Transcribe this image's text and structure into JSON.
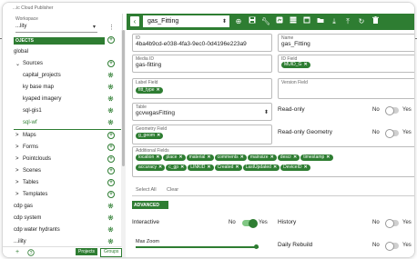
{
  "app": {
    "title": "...ic Cloud Publisher"
  },
  "workspace": {
    "label": "Workspace",
    "value": "...lity"
  },
  "projects_header": "OJECTS",
  "tree": [
    {
      "label": "global",
      "indent": 0,
      "caret": "",
      "action": ""
    },
    {
      "label": "Sources",
      "indent": 2,
      "caret": "⌄",
      "action": "plus"
    },
    {
      "label": "capital_projects",
      "indent": 10,
      "caret": "",
      "action": "gear"
    },
    {
      "label": "ky base map",
      "indent": 10,
      "caret": "",
      "action": "gear"
    },
    {
      "label": "kyaped imagery",
      "indent": 10,
      "caret": "",
      "action": "gear"
    },
    {
      "label": "sql-gis1",
      "indent": 10,
      "caret": "",
      "action": "gear"
    },
    {
      "label": "sql-wf",
      "indent": 10,
      "caret": "",
      "action": "gear",
      "selected": true
    },
    {
      "label": "Maps",
      "indent": 2,
      "caret": ">",
      "action": "plus"
    },
    {
      "label": "Forms",
      "indent": 2,
      "caret": ">",
      "action": "plus"
    },
    {
      "label": "Pointclouds",
      "indent": 2,
      "caret": ">",
      "action": "plus"
    },
    {
      "label": "Scenes",
      "indent": 2,
      "caret": ">",
      "action": "plus"
    },
    {
      "label": "Tables",
      "indent": 2,
      "caret": ">",
      "action": "plus"
    },
    {
      "label": "Templates",
      "indent": 2,
      "caret": ">",
      "action": "plus"
    },
    {
      "label": "cdp gas",
      "indent": 0,
      "caret": "",
      "action": "gear"
    },
    {
      "label": "cdp system",
      "indent": 0,
      "caret": "",
      "action": "gear"
    },
    {
      "label": "cdp water hydrants",
      "indent": 0,
      "caret": "",
      "action": "gear"
    },
    {
      "label": "...ility",
      "indent": 0,
      "caret": "",
      "action": "gear"
    }
  ],
  "footer": {
    "projects_btn": "Projects",
    "groups_btn": "Groups"
  },
  "toolbar": {
    "selected": "gas_Fitting",
    "icons": [
      "add-circle-icon",
      "save-icon",
      "wrench-icon",
      "map-icon",
      "table-icon",
      "window-icon",
      "folder-icon",
      "download-icon",
      "upload-icon",
      "refresh-icon",
      "delete-icon"
    ]
  },
  "form": {
    "id": {
      "label": "ID",
      "value": "4ba4b9cd-e038-4fa3-9ec0-0d4196e223a9"
    },
    "name": {
      "label": "Name",
      "value": "gas_Fitting"
    },
    "media_id": {
      "label": "Media ID",
      "value": "gas-fitting"
    },
    "id_field": {
      "label": "ID Field",
      "chip": "MUID_G"
    },
    "label_field": {
      "label": "Label Field",
      "chip": "fitt_type"
    },
    "version_field": {
      "label": "Version Field",
      "value": ""
    },
    "table": {
      "label": "Table",
      "value": "gcvwgasFitting"
    },
    "geometry_field": {
      "label": "Geometry Field",
      "chip": "g_geom"
    },
    "read_only": {
      "label": "Read-only",
      "no": "No",
      "yes": "Yes",
      "on": false
    },
    "read_only_geometry": {
      "label": "Read-only Geometry",
      "no": "No",
      "yes": "Yes",
      "on": false
    },
    "additional_fields": {
      "label": "Additional Fields",
      "chips_row1": [
        "location",
        "place",
        "material",
        "comments",
        "mainsize",
        "descr",
        "timestamp"
      ],
      "chips_row2": [
        "accuracy",
        "c_gp",
        "LINKID",
        "Created",
        "LastUpdated",
        "DeviceID"
      ]
    },
    "select_all": "Select All",
    "clear": "Clear",
    "advanced": "ADVANCED",
    "interactive": {
      "label": "Interactive",
      "no": "No",
      "yes": "Yes",
      "on": true
    },
    "history": {
      "label": "History",
      "no": "No",
      "yes": "Yes",
      "on": false
    },
    "max_zoom": {
      "label": "Max Zoom"
    },
    "daily_rebuild": {
      "label": "Daily Rebuild",
      "no": "No",
      "yes": "Yes",
      "on": false
    }
  },
  "colors": {
    "primary": "#2e7d32",
    "toggle_on_track": "#81c784"
  }
}
